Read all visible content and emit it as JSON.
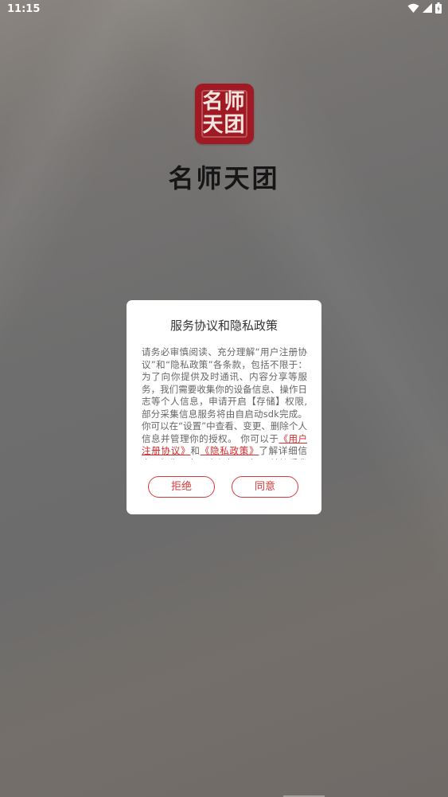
{
  "status_bar": {
    "time": "11:15",
    "icons": [
      "wifi-icon",
      "signal-icon",
      "battery-icon"
    ]
  },
  "logo": {
    "badge_line1": "名师",
    "badge_line2": "天团",
    "brand_name": "名师天团",
    "badge_color": "#a11922"
  },
  "dialog": {
    "title": "服务协议和隐私政策",
    "body_text": "请务必审慎阅读、充分理解“用户注册协议”和“隐私政策”各条款，包括不限于：为了向你提供及时通讯、内容分享等服务，我们需要收集你的设备信息、操作日志等个人信息，申请开启【存储】权限, 部分采集信息服务将由自启动sdk完成。你可以在“设置”中查看、变更、删除个人信息并管理你的授权。 你可以于",
    "link_user_agreement": "《用户注册协议》",
    "and": "和",
    "link_privacy": "《隐私政策》",
    "body_tail": "了解详细信息。如你同意，请点击“同意”开始接受我们的服务。",
    "reject_label": "拒绝",
    "agree_label": "同意",
    "accent_color": "#d9383a"
  }
}
